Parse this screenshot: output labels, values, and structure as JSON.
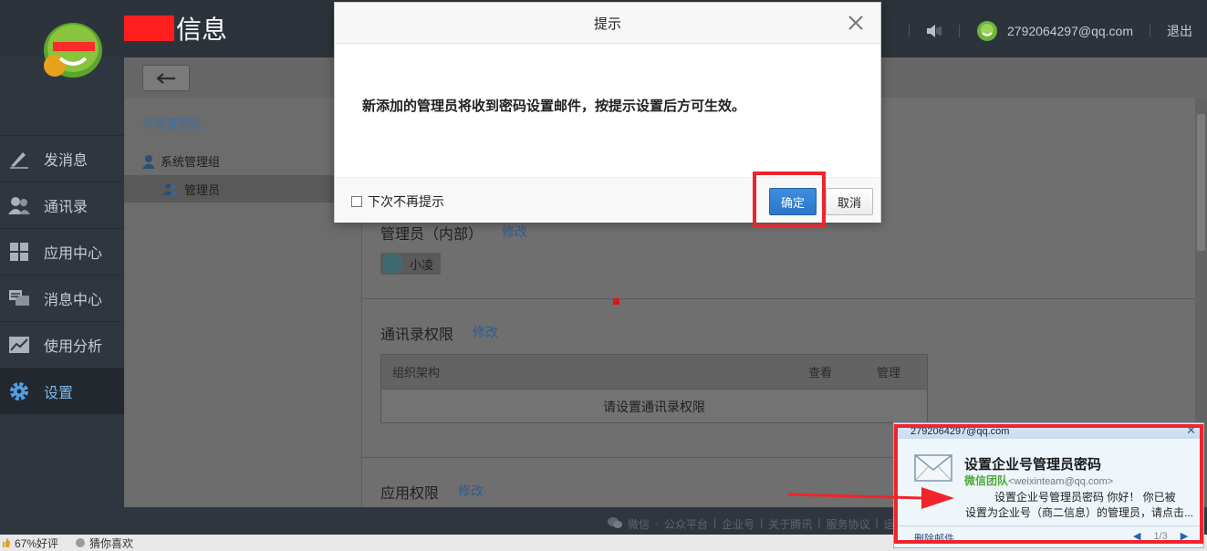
{
  "header": {
    "brand_suffix": "信息",
    "account": "2792064297@qq.com",
    "logout": "退出"
  },
  "sidebar": {
    "items": [
      {
        "label": "发消息",
        "icon": "pencil-icon"
      },
      {
        "label": "通讯录",
        "icon": "contacts-icon"
      },
      {
        "label": "应用中心",
        "icon": "apps-grid-icon"
      },
      {
        "label": "消息中心",
        "icon": "chat-bubbles-icon"
      },
      {
        "label": "使用分析",
        "icon": "line-chart-icon"
      },
      {
        "label": "设置",
        "icon": "gear-icon",
        "active": true
      }
    ]
  },
  "leftpane": {
    "new_group": "新建管理组",
    "tree_root": "系统管理组",
    "tree_child": "管理员"
  },
  "content": {
    "admins_title": "管理员（内部）",
    "admins_edit": "修改",
    "member_name": "小凌",
    "contacts_title": "通讯录权限",
    "contacts_edit": "修改",
    "table": {
      "col_org": "组织架构",
      "col_view": "查看",
      "col_manage": "管理",
      "empty": "请设置通讯录权限"
    },
    "apps_title": "应用权限",
    "apps_edit": "修改"
  },
  "footer": {
    "links": [
      "微信",
      "·",
      "公众平台",
      "|",
      "企业号",
      "|",
      "关于腾讯",
      "|",
      "服务协议",
      "|",
      "运营规"
    ]
  },
  "statusbar": {
    "rating": "67%好评",
    "guess": "猜你喜欢"
  },
  "modal": {
    "title": "提示",
    "message": "新添加的管理员将收到密码设置邮件，按提示设置后方可生效。",
    "checkbox_label": "下次不再提示",
    "ok": "确定",
    "cancel": "取消"
  },
  "notification": {
    "account": "2792064297@qq.com",
    "subject": "设置企业号管理员密码",
    "sender_name": "微信团队",
    "sender_email": "<weixinteam@qq.com>",
    "line1": "设置企业号管理员密码   你好！   你已被",
    "line2": "设置为企业号（商二信息）的管理员，请点击...",
    "delete": "删除邮件",
    "page": "1/3"
  },
  "colors": {
    "accent": "#2b76c8",
    "highlight": "#f0242b",
    "sidebar_bg": "#2f3640",
    "active_nav": "#7ab9ee"
  }
}
